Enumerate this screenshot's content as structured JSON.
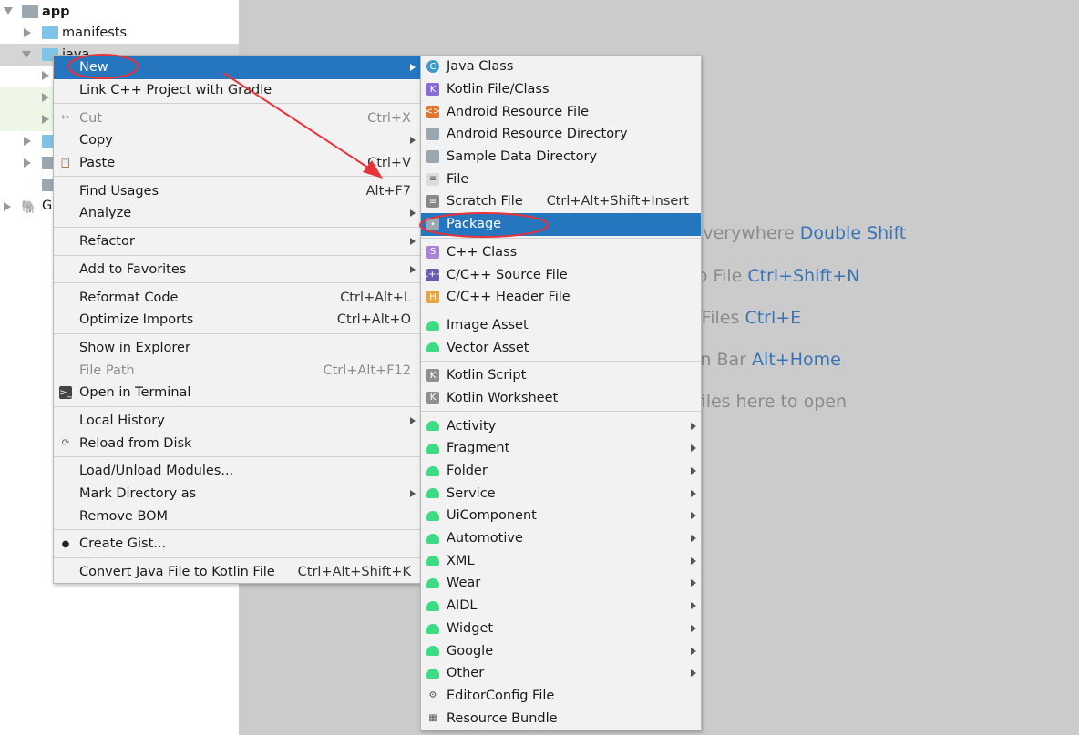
{
  "tree": {
    "items": [
      {
        "label": "app",
        "bold": true
      },
      {
        "label": "manifests"
      },
      {
        "label": "java"
      },
      {
        "label": "Gr"
      }
    ]
  },
  "hints": [
    {
      "text": "Search Everywhere ",
      "key": "Double Shift"
    },
    {
      "text": "Go to File ",
      "key": "Ctrl+Shift+N"
    },
    {
      "text": "Recent Files ",
      "key": "Ctrl+E"
    },
    {
      "text": "Navigation Bar ",
      "key": "Alt+Home"
    },
    {
      "text": "Drop files here to open",
      "key": ""
    }
  ],
  "menu": {
    "items": [
      {
        "label": "New",
        "selected": true,
        "submenu": true
      },
      {
        "label": "Link C++ Project with Gradle"
      },
      {
        "label": "Cut",
        "shortcut": "Ctrl+X",
        "disabled": true,
        "icon": "scissors-icon"
      },
      {
        "label": "Copy",
        "submenu": true
      },
      {
        "label": "Paste",
        "shortcut": "Ctrl+V",
        "icon": "clipboard-icon"
      },
      {
        "label": "Find Usages",
        "shortcut": "Alt+F7"
      },
      {
        "label": "Analyze",
        "submenu": true
      },
      {
        "label": "Refactor",
        "submenu": true
      },
      {
        "label": "Add to Favorites",
        "submenu": true
      },
      {
        "label": "Reformat Code",
        "shortcut": "Ctrl+Alt+L"
      },
      {
        "label": "Optimize Imports",
        "shortcut": "Ctrl+Alt+O"
      },
      {
        "label": "Show in Explorer"
      },
      {
        "label": "File Path",
        "shortcut": "Ctrl+Alt+F12",
        "disabled": true
      },
      {
        "label": "Open in Terminal",
        "icon": "terminal-icon"
      },
      {
        "label": "Local History",
        "submenu": true
      },
      {
        "label": "Reload from Disk",
        "icon": "reload-icon"
      },
      {
        "label": "Load/Unload Modules..."
      },
      {
        "label": "Mark Directory as",
        "submenu": true
      },
      {
        "label": "Remove BOM"
      },
      {
        "label": "Create Gist...",
        "icon": "github-icon"
      },
      {
        "label": "Convert Java File to Kotlin File",
        "shortcut": "Ctrl+Alt+Shift+K"
      }
    ]
  },
  "submenu": {
    "items": [
      {
        "label": "Java Class",
        "icon": "java-class-icon"
      },
      {
        "label": "Kotlin File/Class",
        "icon": "kotlin-file-icon"
      },
      {
        "label": "Android Resource File",
        "icon": "resource-file-icon"
      },
      {
        "label": "Android Resource Directory",
        "icon": "folder-icon"
      },
      {
        "label": "Sample Data Directory",
        "icon": "folder-icon"
      },
      {
        "label": "File",
        "icon": "file-icon"
      },
      {
        "label": "Scratch File",
        "shortcut": "Ctrl+Alt+Shift+Insert",
        "icon": "scratch-file-icon"
      },
      {
        "label": "Package",
        "selected": true,
        "icon": "package-icon"
      },
      {
        "label": "C++ Class",
        "icon": "cpp-class-icon"
      },
      {
        "label": "C/C++ Source File",
        "icon": "cpp-source-icon"
      },
      {
        "label": "C/C++ Header File",
        "icon": "cpp-header-icon"
      },
      {
        "label": "Image Asset",
        "icon": "android-icon"
      },
      {
        "label": "Vector Asset",
        "icon": "android-icon"
      },
      {
        "label": "Kotlin Script",
        "icon": "kotlin-script-icon"
      },
      {
        "label": "Kotlin Worksheet",
        "icon": "kotlin-worksheet-icon"
      },
      {
        "label": "Activity",
        "submenu": true,
        "icon": "android-icon"
      },
      {
        "label": "Fragment",
        "submenu": true,
        "icon": "android-icon"
      },
      {
        "label": "Folder",
        "submenu": true,
        "icon": "android-icon"
      },
      {
        "label": "Service",
        "submenu": true,
        "icon": "android-icon"
      },
      {
        "label": "UiComponent",
        "submenu": true,
        "icon": "android-icon"
      },
      {
        "label": "Automotive",
        "submenu": true,
        "icon": "android-icon"
      },
      {
        "label": "XML",
        "submenu": true,
        "icon": "android-icon"
      },
      {
        "label": "Wear",
        "submenu": true,
        "icon": "android-icon"
      },
      {
        "label": "AIDL",
        "submenu": true,
        "icon": "android-icon"
      },
      {
        "label": "Widget",
        "submenu": true,
        "icon": "android-icon"
      },
      {
        "label": "Google",
        "submenu": true,
        "icon": "android-icon"
      },
      {
        "label": "Other",
        "submenu": true,
        "icon": "android-icon"
      },
      {
        "label": "EditorConfig File",
        "icon": "editorconfig-icon"
      },
      {
        "label": "Resource Bundle",
        "icon": "resource-bundle-icon"
      }
    ]
  },
  "colors": {
    "selection": "#2675bf",
    "annotation": "#e8333a",
    "android": "#3ddc84",
    "hint_key": "#3a73b4"
  }
}
